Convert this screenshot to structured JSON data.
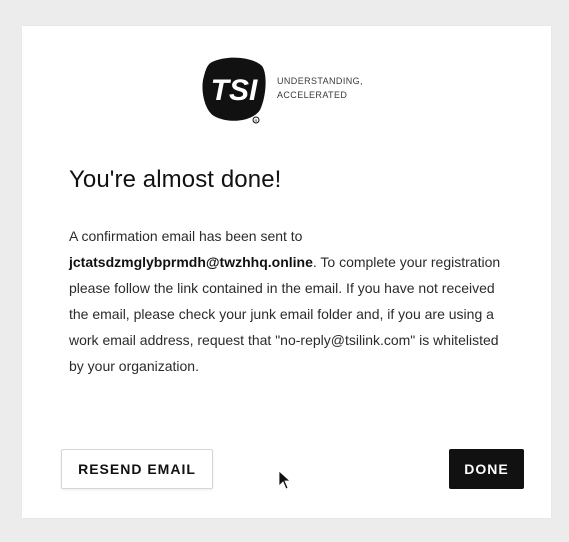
{
  "brand": {
    "logo_text": "TSI",
    "tagline_line1": "UNDERSTANDING,",
    "tagline_line2": "ACCELERATED",
    "colors": {
      "logo": "#111111",
      "text": "#3a3a3a"
    }
  },
  "dialog": {
    "title": "You're almost done!",
    "body_prefix": "A confirmation email has been sent to",
    "email": "jctatsdzmglybprmdh@twzhhq.online",
    "body_suffix": ". To complete your registration please follow the link contained in the email. If you have not received the email, please check your junk email folder and, if you are using a work email address, request that \"no-reply@tsilink.com\" is whitelisted by your organization."
  },
  "buttons": {
    "resend_label": "RESEND EMAIL",
    "done_label": "DONE"
  },
  "colors": {
    "page_background": "#ececec",
    "card_background": "#ffffff",
    "primary_button": "#111111"
  }
}
